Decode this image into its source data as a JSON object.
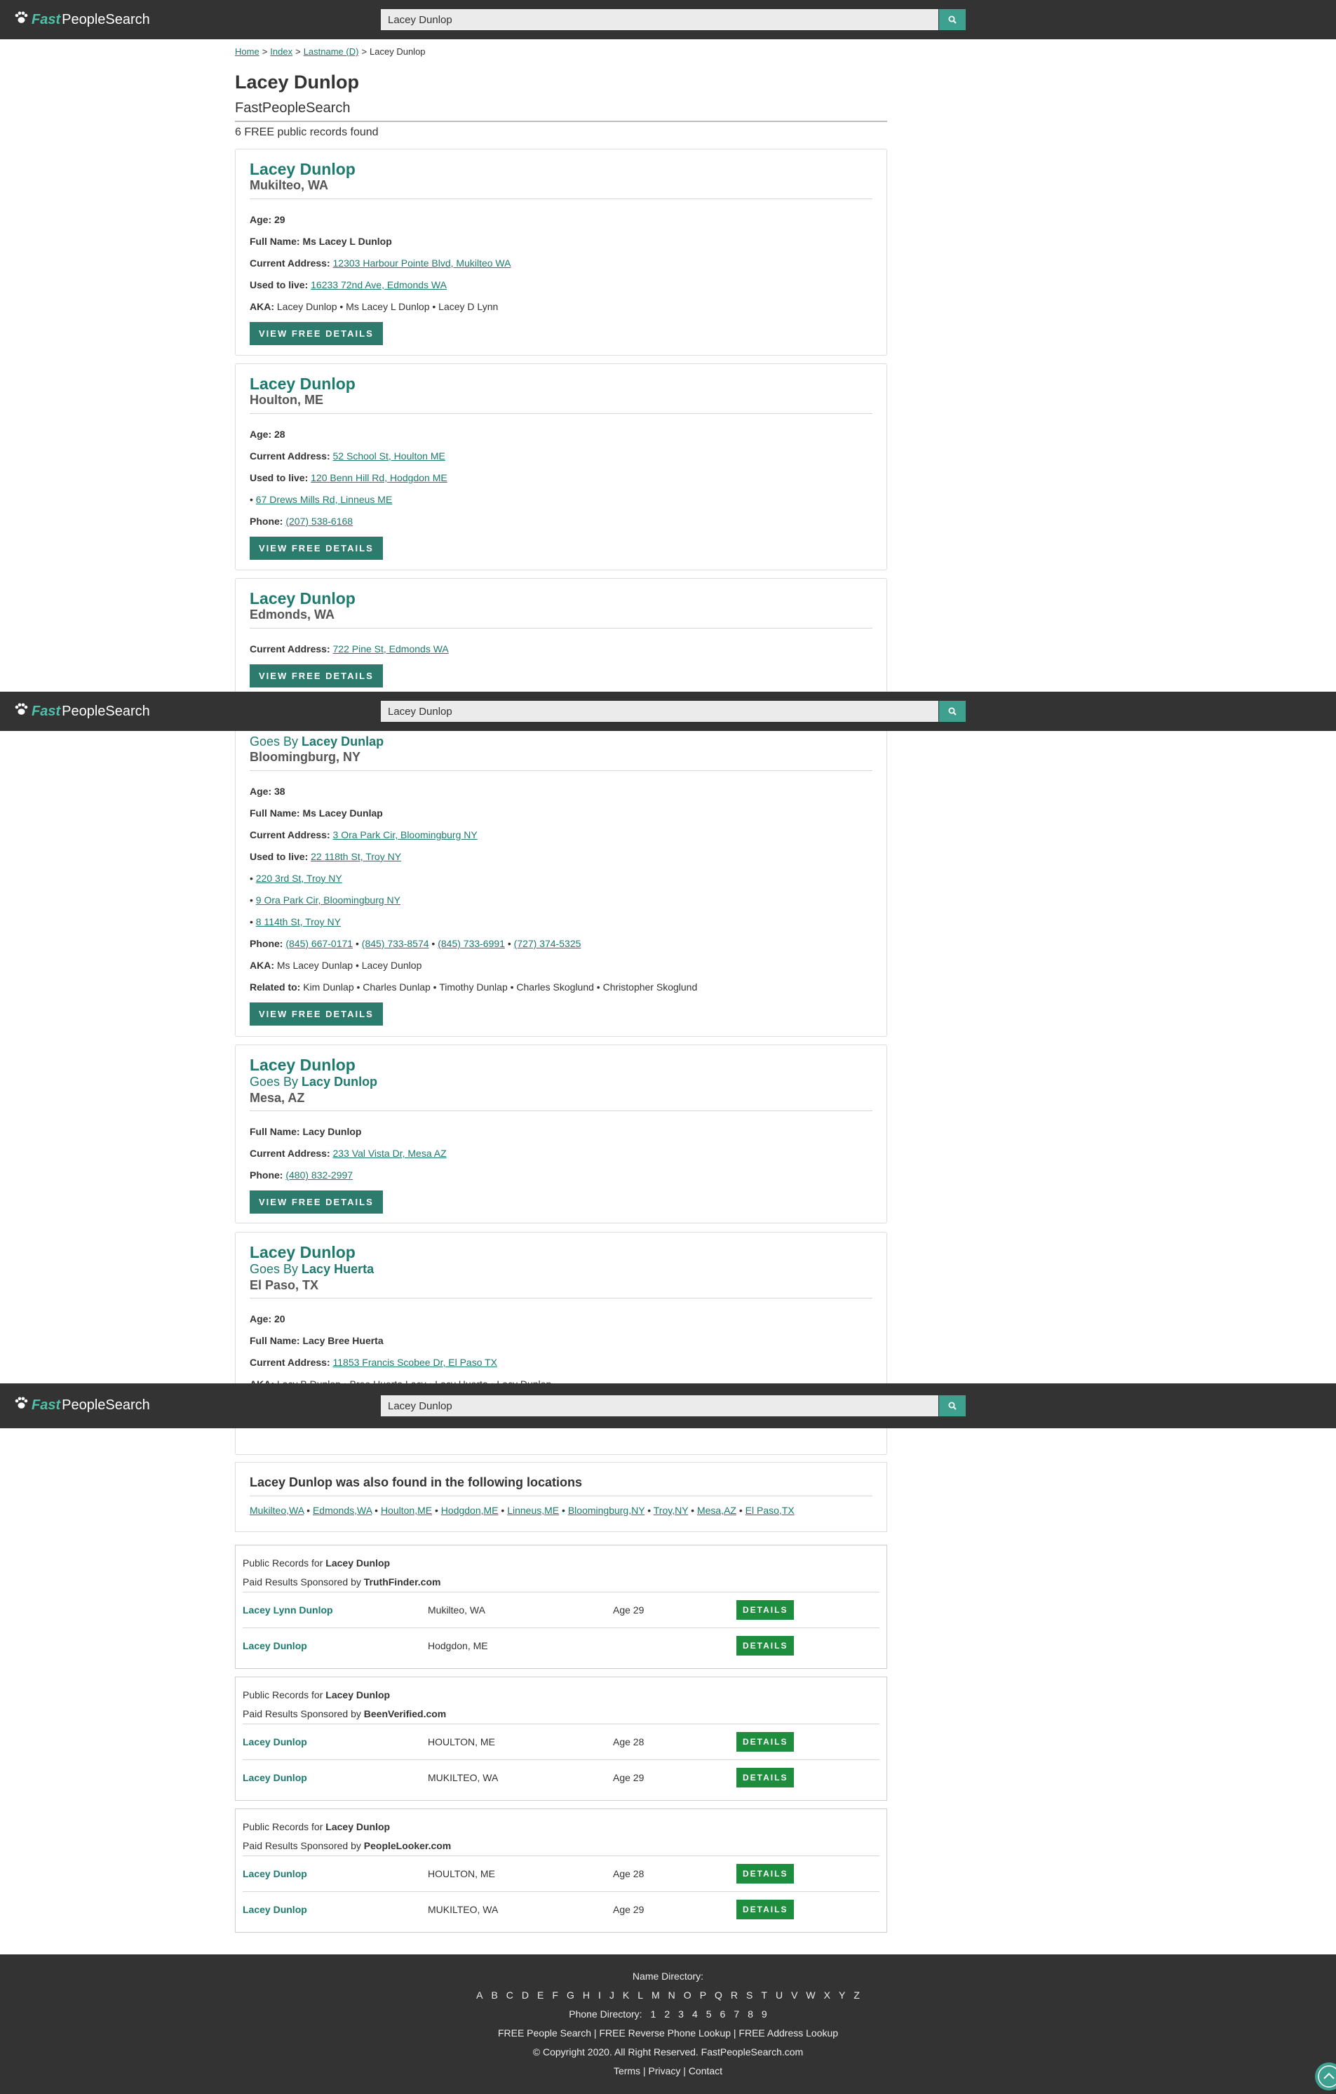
{
  "header": {
    "logo_fast": "Fast",
    "logo_rest": "PeopleSearch",
    "search_value": "Lacey Dunlop",
    "search_icon": "search-icon"
  },
  "breadcrumb": {
    "home": "Home",
    "index": "Index",
    "lastname": "Lastname (D)",
    "current": "Lacey Dunlop"
  },
  "page": {
    "title": "Lacey Dunlop",
    "site": "FastPeopleSearch",
    "count": "6 FREE public records found"
  },
  "labels": {
    "age": "Age:",
    "full_name": "Full Name:",
    "current_address": "Current Address:",
    "used_to_live": "Used to live:",
    "phone": "Phone:",
    "aka": "AKA:",
    "related": "Related to:",
    "goes_by": "Goes By",
    "view_btn": "VIEW FREE DETAILS"
  },
  "records": [
    {
      "name": "Lacey Dunlop",
      "location": "Mukilteo, WA",
      "age": "29",
      "full_name": "Ms Lacey L Dunlop",
      "current_address": "12303 Harbour Pointe Blvd, Mukilteo WA",
      "used_to_live": [
        "16233 72nd Ave, Edmonds WA"
      ],
      "aka": "Lacey Dunlop • Ms Lacey L Dunlop • Lacey D Lynn"
    },
    {
      "name": "Lacey Dunlop",
      "location": "Houlton, ME",
      "age": "28",
      "current_address": "52 School St, Houlton ME",
      "used_to_live": [
        "120 Benn Hill Rd, Hodgdon ME",
        "67 Drews Mills Rd, Linneus ME"
      ],
      "phones": [
        "(207) 538-6168"
      ]
    },
    {
      "name": "Lacey Dunlop",
      "location": "Edmonds, WA",
      "current_address": "722 Pine St, Edmonds WA"
    },
    {
      "goes_by": "Lacey Dunlap",
      "location": "Bloomingburg, NY",
      "age": "38",
      "full_name": "Ms Lacey Dunlap",
      "current_address": "3 Ora Park Cir, Bloomingburg NY",
      "used_to_live": [
        "22 118th St, Troy NY",
        "220 3rd St, Troy NY",
        "9 Ora Park Cir, Bloomingburg NY",
        "8 114th St, Troy NY"
      ],
      "phones": [
        "(845) 667-0171",
        "(845) 733-8574",
        "(845) 733-6991",
        "(727) 374-5325"
      ],
      "aka": "Ms Lacey Dunlap • Lacey Dunlop",
      "related": "Kim Dunlap • Charles Dunlap • Timothy Dunlap • Charles Skoglund • Christopher Skoglund"
    },
    {
      "name": "Lacey Dunlop",
      "goes_by": "Lacy Dunlop",
      "location": "Mesa, AZ",
      "full_name": "Lacy Dunlop",
      "current_address": "233 Val Vista Dr, Mesa AZ",
      "phones": [
        "(480) 832-2997"
      ]
    },
    {
      "name": "Lacey Dunlop",
      "goes_by": "Lacy Huerta",
      "location": "El Paso, TX",
      "age": "20",
      "full_name": "Lacy Bree Huerta",
      "current_address": "11853 Francis Scobee Dr, El Paso TX",
      "aka": "Lacy B Dunlop • Bree Huerta Lacy • Lacy Huerta • Lacy Dunlop"
    }
  ],
  "locations": {
    "title": "Lacey Dunlop was also found in the following locations",
    "items": [
      "Mukilteo,WA",
      "Edmonds,WA",
      "Houlton,ME",
      "Hodgdon,ME",
      "Linneus,ME",
      "Bloomingburg,NY",
      "Troy,NY",
      "Mesa,AZ",
      "El Paso,TX"
    ]
  },
  "sponsors": [
    {
      "prefix": "Public Records for",
      "name": "Lacey Dunlop",
      "paid": "Paid Results Sponsored by",
      "site": "TruthFinder.com",
      "rows": [
        {
          "name": "Lacey Lynn Dunlop",
          "location": "Mukilteo, WA",
          "age": "Age 29",
          "btn": "DETAILS"
        },
        {
          "name": "Lacey Dunlop",
          "location": "Hodgdon, ME",
          "age": "",
          "btn": "DETAILS"
        }
      ]
    },
    {
      "prefix": "Public Records for",
      "name": "Lacey Dunlop",
      "paid": "Paid Results Sponsored by",
      "site": "BeenVerified.com",
      "rows": [
        {
          "name": "Lacey Dunlop",
          "location": "HOULTON, ME",
          "age": "Age 28",
          "btn": "DETAILS"
        },
        {
          "name": "Lacey Dunlop",
          "location": "MUKILTEO, WA",
          "age": "Age 29",
          "btn": "DETAILS"
        }
      ]
    },
    {
      "prefix": "Public Records for",
      "name": "Lacey Dunlop",
      "paid": "Paid Results Sponsored by",
      "site": "PeopleLooker.com",
      "rows": [
        {
          "name": "Lacey Dunlop",
          "location": "HOULTON, ME",
          "age": "Age 28",
          "btn": "DETAILS"
        },
        {
          "name": "Lacey Dunlop",
          "location": "MUKILTEO, WA",
          "age": "Age 29",
          "btn": "DETAILS"
        }
      ]
    }
  ],
  "footer": {
    "name_dir": "Name Directory:",
    "letters": [
      "A",
      "B",
      "C",
      "D",
      "E",
      "F",
      "G",
      "H",
      "I",
      "J",
      "K",
      "L",
      "M",
      "N",
      "O",
      "P",
      "Q",
      "R",
      "S",
      "T",
      "U",
      "V",
      "W",
      "X",
      "Y",
      "Z"
    ],
    "phone_dir": "Phone Directory:",
    "digits": [
      "1",
      "2",
      "3",
      "4",
      "5",
      "6",
      "7",
      "8",
      "9"
    ],
    "free_people": "FREE People Search",
    "free_phone": "FREE Reverse Phone Lookup",
    "free_address": "FREE Address Lookup",
    "copyright": "© Copyright 2020. All Right Reserved. FastPeopleSearch.com",
    "terms": "Terms",
    "privacy": "Privacy",
    "contact": "Contact",
    "sep": "|"
  },
  "colors": {
    "header_bg": "#333333",
    "brand_teal": "#4fc1a9",
    "link": "#1d7a6e",
    "view_button": "#2c7b6d",
    "details_button": "#1e8e3e"
  }
}
